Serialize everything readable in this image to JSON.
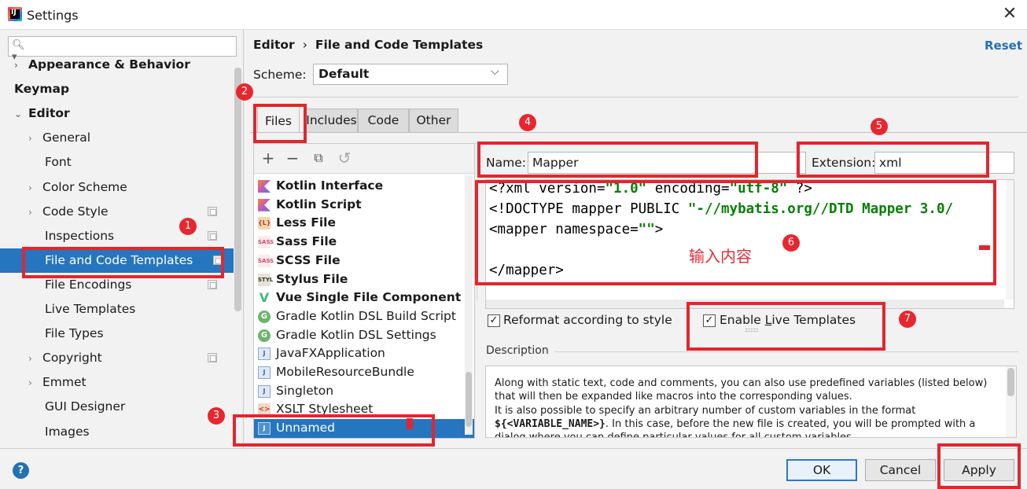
{
  "window": {
    "title": "Settings",
    "app_icon_text": "IJ"
  },
  "sidebar": {
    "search": {
      "value": "",
      "placeholder": ""
    },
    "items": [
      {
        "label": "Appearance & Behavior",
        "expander": "›",
        "bold": true
      },
      {
        "label": "Keymap",
        "bold": true
      },
      {
        "label": "Editor",
        "expander": "⌄",
        "bold": true
      },
      {
        "label": "General",
        "expander": "›"
      },
      {
        "label": "Font"
      },
      {
        "label": "Color Scheme",
        "expander": "›"
      },
      {
        "label": "Code Style",
        "expander": "›"
      },
      {
        "label": "Inspections"
      },
      {
        "label": "File and Code Templates",
        "selected": true
      },
      {
        "label": "File Encodings"
      },
      {
        "label": "Live Templates"
      },
      {
        "label": "File Types"
      },
      {
        "label": "Copyright",
        "expander": "›"
      },
      {
        "label": "Emmet",
        "expander": "›"
      },
      {
        "label": "GUI Designer"
      },
      {
        "label": "Images"
      }
    ]
  },
  "header": {
    "breadcrumb": [
      "Editor",
      "File and Code Templates"
    ],
    "separator": "›",
    "reset_label": "Reset"
  },
  "scheme": {
    "label": "Scheme:",
    "selected": "Default"
  },
  "tabs": [
    {
      "label": "Files",
      "active": true
    },
    {
      "label": "Includes"
    },
    {
      "label": "Code"
    },
    {
      "label": "Other"
    }
  ],
  "toolbar": {
    "add": "+",
    "remove": "−",
    "copy": "⧉",
    "revert": "↺"
  },
  "templates": [
    {
      "name": "Kotlin Interface",
      "icon": "kotlin-icon",
      "icon_text": "",
      "bold": true
    },
    {
      "name": "Kotlin Script",
      "icon": "kotlin-icon",
      "icon_text": "",
      "bold": true
    },
    {
      "name": "Less File",
      "icon": "less-icon",
      "icon_text": "{L}",
      "bold": true
    },
    {
      "name": "Sass File",
      "icon": "sass-icon",
      "icon_text": "SASS",
      "bold": true
    },
    {
      "name": "SCSS File",
      "icon": "sass-icon",
      "icon_text": "SASS",
      "bold": true
    },
    {
      "name": "Stylus File",
      "icon": "stylus-icon",
      "icon_text": "STYL",
      "bold": true
    },
    {
      "name": "Vue Single File Component",
      "icon": "vue-icon",
      "icon_text": "V",
      "bold": true
    },
    {
      "name": "Gradle Kotlin DSL Build Script",
      "icon": "gradle-icon",
      "icon_text": "G"
    },
    {
      "name": "Gradle Kotlin DSL Settings",
      "icon": "gradle-icon",
      "icon_text": "G"
    },
    {
      "name": "JavaFXApplication",
      "icon": "java-file-icon",
      "icon_text": "J"
    },
    {
      "name": "MobileResourceBundle",
      "icon": "java-file-icon",
      "icon_text": "J"
    },
    {
      "name": "Singleton",
      "icon": "java-file-icon",
      "icon_text": "J"
    },
    {
      "name": "XSLT Stylesheet",
      "icon": "xslt-icon",
      "icon_text": "<>"
    },
    {
      "name": "Unnamed",
      "icon": "unnamed-file-icon",
      "icon_text": "J",
      "selected": true
    }
  ],
  "template_form": {
    "name_label": "Name:",
    "name_value": "Mapper",
    "extension_label": "Extension:",
    "extension_value": "xml"
  },
  "editor": {
    "line1_a": "<?xml version=",
    "line1_s1": "\"1.0\"",
    "line1_b": " encoding=",
    "line1_s2": "\"utf-8\"",
    "line1_c": " ?>",
    "line2_a": "<!DOCTYPE mapper PUBLIC ",
    "line2_s": "\"-//mybatis.org//DTD Mapper 3.0/",
    "line3_a": "<mapper namespace=",
    "line3_s": "\"\"",
    "line3_c": ">",
    "line5": "</mapper>"
  },
  "annotation": {
    "note": "输入内容",
    "color": "#e2262e",
    "badges": [
      "1",
      "2",
      "3",
      "4",
      "5",
      "6",
      "7"
    ]
  },
  "options": {
    "reformat_label": "Reformat according to style",
    "reformat_checked": true,
    "live_label_pre": "Enable ",
    "live_label_u": "L",
    "live_label_post": "ive Templates",
    "live_checked": true,
    "check_glyph": "✓"
  },
  "description": {
    "label": "Description",
    "text1": "Along with static text, code and comments, you can also use predefined variables (listed below) that will then be expanded like macros into the corresponding values.",
    "text2": "It is also possible to specify an arbitrary number of custom variables in the format",
    "text3_mono": "${<VARIABLE_NAME>}",
    "text3": ". In this case, before the new file is created, you will be prompted with a dialog where you can define particular values for all custom variables."
  },
  "buttons": {
    "ok": "OK",
    "cancel": "Cancel",
    "apply": "Apply",
    "help": "?"
  },
  "colors": {
    "selection": "#2675bf",
    "link": "#2470b3",
    "string": "#068006"
  }
}
